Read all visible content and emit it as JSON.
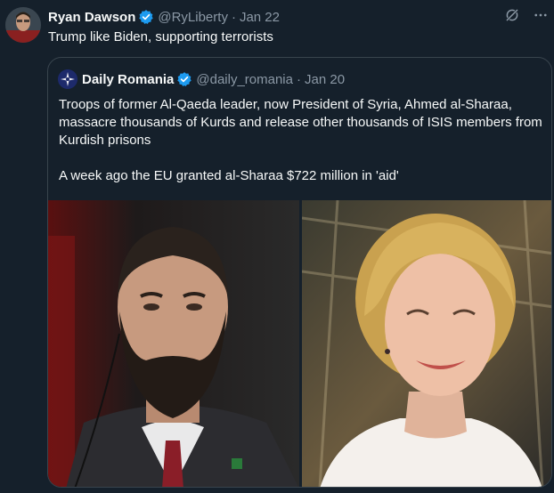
{
  "tweet": {
    "author_name": "Ryan Dawson",
    "handle": "@RyLiberty",
    "separator": "·",
    "time": "Jan 22",
    "text": "Trump like Biden, supporting terrorists"
  },
  "quote": {
    "author_name": "Daily Romania",
    "handle": "@daily_romania",
    "separator": "·",
    "time": "Jan 20",
    "paragraph1": "Troops of former Al-Qaeda leader, now President of Syria, Ahmed al-Sharaa, massacre thousands of Kurds and release other thousands of ISIS members from Kurdish prisons",
    "paragraph2": "A week ago the EU granted al-Sharaa $722 million in 'aid'"
  },
  "icons": {
    "verified": "verified-badge-icon",
    "grok": "grok-icon",
    "more": "more-icon"
  },
  "colors": {
    "background": "#15202b",
    "text": "#f7f9f9",
    "secondary": "#8b98a5",
    "verified": "#1d9bf0",
    "border": "#38444d"
  }
}
